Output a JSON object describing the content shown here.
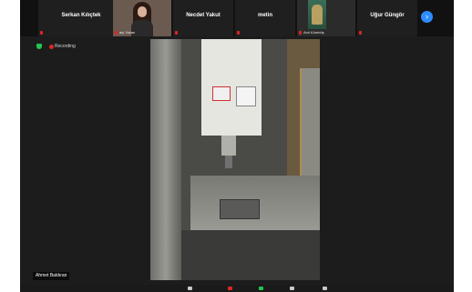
{
  "participants": [
    {
      "name": "Serkan Kılıçtek",
      "type": "name"
    },
    {
      "label": "aiç Yakan",
      "type": "video"
    },
    {
      "name": "Necdet Yakut",
      "type": "name"
    },
    {
      "name": "metin",
      "type": "name"
    },
    {
      "label": "Anıl Kümbüş",
      "type": "avatar"
    },
    {
      "name": "Uğur Güngör",
      "type": "name"
    }
  ],
  "status": {
    "recording_label": "Recording"
  },
  "speaker": {
    "name": "Ahmet Baldıran"
  },
  "colors": {
    "accent": "#2d8cff",
    "recording": "#e02424",
    "secure": "#23c552",
    "muted": "#e02424"
  }
}
